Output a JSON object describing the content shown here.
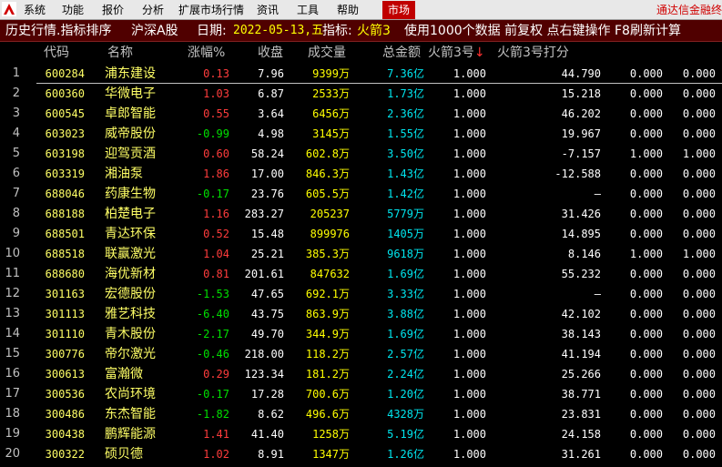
{
  "menu": {
    "items": [
      "系统",
      "功能",
      "报价",
      "分析",
      "扩展市场行情",
      "资讯",
      "工具",
      "帮助"
    ],
    "market_tab": "市场",
    "right_text": "通达信金融终"
  },
  "info": {
    "title": "历史行情.指标排序",
    "market": "沪深A股",
    "date_label": "日期:",
    "date": "2022-05-13,五",
    "indicator_label": "指标:",
    "indicator": "火箭3",
    "notes": "使用1000个数据 前复权 点右键操作 F8刷新计算"
  },
  "table": {
    "headers": {
      "code": "代码",
      "name": "名称",
      "change": "涨幅%",
      "close": "收盘",
      "volume": "成交量",
      "amount": "总金额",
      "h1": "火箭3号",
      "h1_arrow": "↓",
      "h2": "火箭3号打分"
    },
    "rows": [
      {
        "idx": "1",
        "code": "600284",
        "name": "浦东建设",
        "change": "0.13",
        "dir": "up",
        "close": "7.96",
        "volume": "9399万",
        "amount": "7.36亿",
        "h1": "1.000",
        "h2": "44.790",
        "h3": "0.000",
        "h4": "0.000"
      },
      {
        "idx": "2",
        "code": "600360",
        "name": "华微电子",
        "change": "1.03",
        "dir": "up",
        "close": "6.87",
        "volume": "2533万",
        "amount": "1.73亿",
        "h1": "1.000",
        "h2": "15.218",
        "h3": "0.000",
        "h4": "0.000"
      },
      {
        "idx": "3",
        "code": "600545",
        "name": "卓郎智能",
        "change": "0.55",
        "dir": "up",
        "close": "3.64",
        "volume": "6456万",
        "amount": "2.36亿",
        "h1": "1.000",
        "h2": "46.202",
        "h3": "0.000",
        "h4": "0.000"
      },
      {
        "idx": "4",
        "code": "603023",
        "name": "威帝股份",
        "change": "-0.99",
        "dir": "down",
        "close": "4.98",
        "volume": "3145万",
        "amount": "1.55亿",
        "h1": "1.000",
        "h2": "19.967",
        "h3": "0.000",
        "h4": "0.000"
      },
      {
        "idx": "5",
        "code": "603198",
        "name": "迎驾贡酒",
        "change": "0.60",
        "dir": "up",
        "close": "58.24",
        "volume": "602.8万",
        "amount": "3.50亿",
        "h1": "1.000",
        "h2": "-7.157",
        "h3": "1.000",
        "h4": "1.000"
      },
      {
        "idx": "6",
        "code": "603319",
        "name": "湘油泵",
        "change": "1.86",
        "dir": "up",
        "close": "17.00",
        "volume": "846.3万",
        "amount": "1.43亿",
        "h1": "1.000",
        "h2": "-12.588",
        "h3": "0.000",
        "h4": "0.000"
      },
      {
        "idx": "7",
        "code": "688046",
        "name": "药康生物",
        "change": "-0.17",
        "dir": "down",
        "close": "23.76",
        "volume": "605.5万",
        "amount": "1.42亿",
        "h1": "1.000",
        "h2": "–",
        "h3": "0.000",
        "h4": "0.000"
      },
      {
        "idx": "8",
        "code": "688188",
        "name": "柏楚电子",
        "change": "1.16",
        "dir": "up",
        "close": "283.27",
        "volume": "205237",
        "amount": "5779万",
        "h1": "1.000",
        "h2": "31.426",
        "h3": "0.000",
        "h4": "0.000"
      },
      {
        "idx": "9",
        "code": "688501",
        "name": "青达环保",
        "change": "0.52",
        "dir": "up",
        "close": "15.48",
        "volume": "899976",
        "amount": "1405万",
        "h1": "1.000",
        "h2": "14.895",
        "h3": "0.000",
        "h4": "0.000"
      },
      {
        "idx": "10",
        "code": "688518",
        "name": "联赢激光",
        "change": "1.04",
        "dir": "up",
        "close": "25.21",
        "volume": "385.3万",
        "amount": "9618万",
        "h1": "1.000",
        "h2": "8.146",
        "h3": "1.000",
        "h4": "1.000"
      },
      {
        "idx": "11",
        "code": "688680",
        "name": "海优新材",
        "change": "0.81",
        "dir": "up",
        "close": "201.61",
        "volume": "847632",
        "amount": "1.69亿",
        "h1": "1.000",
        "h2": "55.232",
        "h3": "0.000",
        "h4": "0.000"
      },
      {
        "idx": "12",
        "code": "301163",
        "name": "宏德股份",
        "change": "-1.53",
        "dir": "down",
        "close": "47.65",
        "volume": "692.1万",
        "amount": "3.33亿",
        "h1": "1.000",
        "h2": "–",
        "h3": "0.000",
        "h4": "0.000"
      },
      {
        "idx": "13",
        "code": "301113",
        "name": "雅艺科技",
        "change": "-6.40",
        "dir": "down",
        "close": "43.75",
        "volume": "863.9万",
        "amount": "3.88亿",
        "h1": "1.000",
        "h2": "42.102",
        "h3": "0.000",
        "h4": "0.000"
      },
      {
        "idx": "14",
        "code": "301110",
        "name": "青木股份",
        "change": "-2.17",
        "dir": "down",
        "close": "49.70",
        "volume": "344.9万",
        "amount": "1.69亿",
        "h1": "1.000",
        "h2": "38.143",
        "h3": "0.000",
        "h4": "0.000"
      },
      {
        "idx": "15",
        "code": "300776",
        "name": "帝尔激光",
        "change": "-0.46",
        "dir": "down",
        "close": "218.00",
        "volume": "118.2万",
        "amount": "2.57亿",
        "h1": "1.000",
        "h2": "41.194",
        "h3": "0.000",
        "h4": "0.000"
      },
      {
        "idx": "16",
        "code": "300613",
        "name": "富瀚微",
        "change": "0.29",
        "dir": "up",
        "close": "123.34",
        "volume": "181.2万",
        "amount": "2.24亿",
        "h1": "1.000",
        "h2": "25.266",
        "h3": "0.000",
        "h4": "0.000"
      },
      {
        "idx": "17",
        "code": "300536",
        "name": "农尚环境",
        "change": "-0.17",
        "dir": "down",
        "close": "17.28",
        "volume": "700.6万",
        "amount": "1.20亿",
        "h1": "1.000",
        "h2": "38.771",
        "h3": "0.000",
        "h4": "0.000"
      },
      {
        "idx": "18",
        "code": "300486",
        "name": "东杰智能",
        "change": "-1.82",
        "dir": "down",
        "close": "8.62",
        "volume": "496.6万",
        "amount": "4328万",
        "h1": "1.000",
        "h2": "23.831",
        "h3": "0.000",
        "h4": "0.000"
      },
      {
        "idx": "19",
        "code": "300438",
        "name": "鹏辉能源",
        "change": "1.41",
        "dir": "up",
        "close": "41.40",
        "volume": "1258万",
        "amount": "5.19亿",
        "h1": "1.000",
        "h2": "24.158",
        "h3": "0.000",
        "h4": "0.000"
      },
      {
        "idx": "20",
        "code": "300322",
        "name": "硕贝德",
        "change": "1.02",
        "dir": "up",
        "close": "8.91",
        "volume": "1347万",
        "amount": "1.26亿",
        "h1": "1.000",
        "h2": "31.261",
        "h3": "0.000",
        "h4": "0.000"
      }
    ]
  },
  "colors": {
    "up": "#ff3c3c",
    "down": "#00e000",
    "code_name": "#ffff66",
    "amount": "#00e5ee",
    "info_background": "#500000"
  },
  "icons": {
    "app_logo": "app-logo-icon",
    "sort": "sort-desc-arrow-icon"
  }
}
